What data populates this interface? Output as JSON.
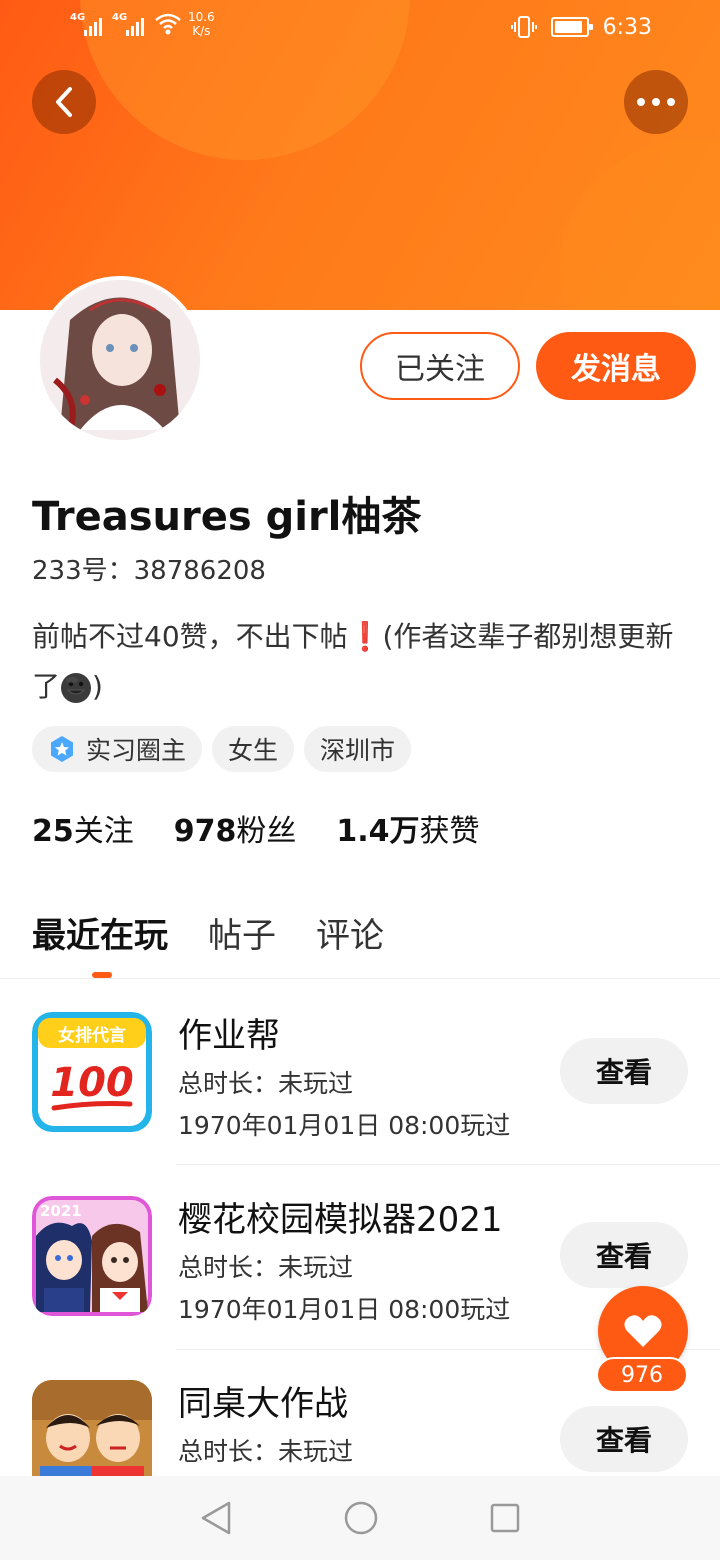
{
  "status_bar": {
    "signal1_label": "4G",
    "signal2_label": "4G",
    "net_speed_value": "10.6",
    "net_speed_unit": "K/s",
    "time": "6:33",
    "battery_level": 0.9
  },
  "header": {
    "back_icon": "chevron-left-icon",
    "more_icon": "more-dots-icon",
    "accent_color": "#ff5a14"
  },
  "profile": {
    "followed_label": "已关注",
    "message_label": "发消息",
    "username": "Treasures girl柚茶",
    "user_id": "233号：38786208",
    "bio_text": "前帖不过40赞，不出下帖❗(作者这辈子都别想更新了",
    "bio_end": ")",
    "bio_emoji": "grinning-dark-face-emoji",
    "tags": [
      {
        "icon": "star-badge-icon",
        "label": "实习圈主"
      },
      {
        "label": "女生"
      },
      {
        "label": "深圳市"
      }
    ],
    "stats": [
      {
        "value": "25",
        "label": "关注"
      },
      {
        "value": "978",
        "label": "粉丝"
      },
      {
        "value": "1.4万",
        "label": "获赞"
      }
    ]
  },
  "tabs": [
    {
      "label": "最近在玩",
      "active": true
    },
    {
      "label": "帖子",
      "active": false
    },
    {
      "label": "评论",
      "active": false
    }
  ],
  "games": [
    {
      "title": "作业帮",
      "duration": "总时长：未玩过",
      "last_played": "1970年01月01日 08:00玩过",
      "button": "查看",
      "icon_badge": "女排代言",
      "icon_number": "100"
    },
    {
      "title": "樱花校园模拟器2021",
      "duration": "总时长：未玩过",
      "last_played": "1970年01月01日 08:00玩过",
      "button": "查看",
      "icon_badge": "2021"
    },
    {
      "title": "同桌大作战",
      "duration": "总时长：未玩过",
      "last_played": "",
      "button": "查看"
    }
  ],
  "like_fab": {
    "icon": "heart-icon",
    "count": "976"
  },
  "nav_bar": {
    "back_icon": "nav-back-icon",
    "home_icon": "nav-home-icon",
    "recents_icon": "nav-recents-icon"
  }
}
